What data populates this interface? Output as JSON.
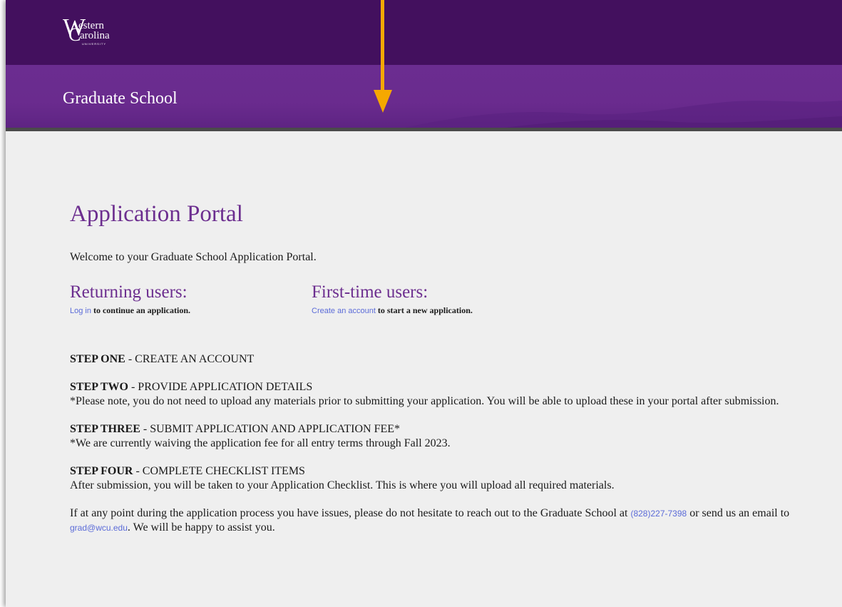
{
  "header": {
    "logo": {
      "letter_w": "W",
      "letter_c": "C",
      "line1": "estern",
      "line2": "arolina",
      "line3": "UNIVERSITY"
    },
    "site_title": "Graduate School"
  },
  "main": {
    "title": "Application Portal",
    "welcome": "Welcome to your Graduate School Application Portal.",
    "returning": {
      "heading": "Returning users:",
      "link": "Log in",
      "text": " to continue an application."
    },
    "first_time": {
      "heading": "First-time users:",
      "link": "Create an account",
      "text": " to start a new application."
    },
    "steps": [
      {
        "label": "STEP ONE",
        "title": " - CREATE AN ACCOUNT",
        "note": ""
      },
      {
        "label": "STEP TWO",
        "title": " -  PROVIDE APPLICATION DETAILS",
        "note": "*Please note, you do not need to upload any materials prior to submitting your application. You will be able to upload these in your portal after submission."
      },
      {
        "label": "STEP THREE",
        "title": " -  SUBMIT APPLICATION AND APPLICATION FEE*",
        "note": "*We are currently waiving the application fee for all entry terms through Fall 2023."
      },
      {
        "label": "STEP FOUR",
        "title": " -  COMPLETE CHECKLIST ITEMS",
        "note": "After submission, you will be taken to your Application Checklist. This is where you will upload all required materials."
      }
    ],
    "help": {
      "prefix": "If at any point during the application process you have issues, please do not hesitate to reach out to the Graduate School at ",
      "phone": "(828)227-7398",
      "middle": " or send us an email to ",
      "email": "grad@wcu.edu",
      "suffix": ". We will be happy to assist you."
    }
  },
  "annotation": {
    "arrow_color": "#f5a800",
    "arrow_icon": "arrow-down-icon"
  },
  "colors": {
    "header_dark": "#43105e",
    "header_band": "#6b2d90",
    "heading_purple": "#6c2e8f",
    "link_blue": "#5b6bd8",
    "page_bg": "#efefef"
  }
}
